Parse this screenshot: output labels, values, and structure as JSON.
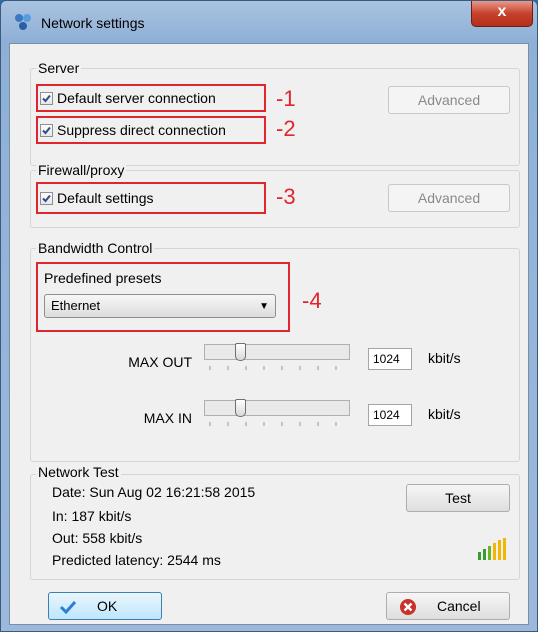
{
  "window": {
    "title": "Network settings",
    "close_label": "x"
  },
  "server": {
    "title": "Server",
    "default_connection_label": "Default server connection",
    "suppress_direct_label": "Suppress direct connection",
    "advanced_label": "Advanced"
  },
  "firewall": {
    "title": "Firewall/proxy",
    "default_settings_label": "Default settings",
    "advanced_label": "Advanced"
  },
  "bandwidth": {
    "title": "Bandwidth Control",
    "presets_label": "Predefined presets",
    "preset_value": "Ethernet",
    "max_out_label": "MAX OUT",
    "max_out_value": "1024",
    "max_in_label": "MAX IN",
    "max_in_value": "1024",
    "unit": "kbit/s"
  },
  "network_test": {
    "title": "Network Test",
    "date": "Date: Sun Aug 02 16:21:58 2015",
    "in": "In: 187 kbit/s",
    "out": "Out: 558 kbit/s",
    "latency": "Predicted latency: 2544 ms",
    "test_label": "Test"
  },
  "footer": {
    "ok_label": "OK",
    "cancel_label": "Cancel"
  },
  "annotations": [
    "-1",
    "-2",
    "-3",
    "-4"
  ],
  "colors": {
    "annotation": "#e0262c",
    "signal": "#f2b705"
  }
}
